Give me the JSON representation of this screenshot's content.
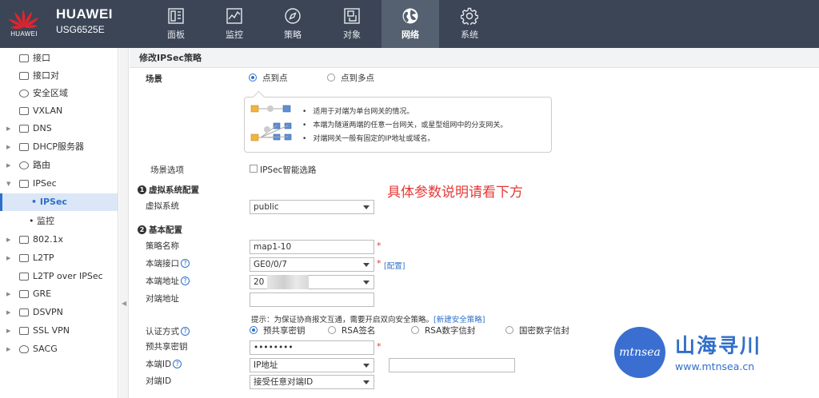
{
  "header": {
    "logo_text": "HUAWEI",
    "brand": "HUAWEI",
    "model": "USG6525E",
    "tabs": [
      {
        "label": "面板",
        "icon": "dashboard-icon"
      },
      {
        "label": "监控",
        "icon": "monitor-icon"
      },
      {
        "label": "策略",
        "icon": "compass-icon"
      },
      {
        "label": "对象",
        "icon": "object-icon"
      },
      {
        "label": "网络",
        "icon": "globe-icon",
        "active": true
      },
      {
        "label": "系统",
        "icon": "gear-icon"
      }
    ]
  },
  "sidebar": {
    "items": [
      {
        "label": "接口",
        "expandable": false
      },
      {
        "label": "接口对",
        "expandable": false
      },
      {
        "label": "安全区域",
        "expandable": false
      },
      {
        "label": "VXLAN",
        "expandable": false
      },
      {
        "label": "DNS",
        "expandable": true
      },
      {
        "label": "DHCP服务器",
        "expandable": true
      },
      {
        "label": "路由",
        "expandable": true
      },
      {
        "label": "IPSec",
        "expandable": true,
        "expanded": true
      },
      {
        "label": "IPSec",
        "sub": true,
        "active": true
      },
      {
        "label": "监控",
        "sub": true
      },
      {
        "label": "802.1x",
        "expandable": true
      },
      {
        "label": "L2TP",
        "expandable": true
      },
      {
        "label": "L2TP over IPSec",
        "expandable": false
      },
      {
        "label": "GRE",
        "expandable": true
      },
      {
        "label": "DSVPN",
        "expandable": true
      },
      {
        "label": "SSL VPN",
        "expandable": true
      },
      {
        "label": "SACG",
        "expandable": true
      }
    ]
  },
  "page": {
    "title": "修改IPSec策略",
    "scene_label": "场景",
    "scene_options": [
      "点到点",
      "点到多点"
    ],
    "scene_selected": 0,
    "scene_info": [
      "适用于对端为单台网关的情况。",
      "本端为隧道两端的任意一台网关，或星型组网中的分支网关。",
      "对端网关一般有固定的IP地址或域名。"
    ],
    "scene_option_label": "场景选项",
    "smart_route_label": "IPSec智能选路",
    "section1": "虚拟系统配置",
    "vsys_label": "虚拟系统",
    "vsys_value": "public",
    "section2": "基本配置",
    "policy_name_label": "策略名称",
    "policy_name_value": "map1-10",
    "local_if_label": "本端接口",
    "local_if_value": "GE0/0/7",
    "config_link": "[配置]",
    "local_addr_label": "本端地址",
    "local_addr_value": "20",
    "peer_addr_label": "对端地址",
    "peer_addr_value": "",
    "tip_text": "提示：为保证协商报文互通，需要开启双向安全策略。",
    "tip_link": "[新建安全策略]",
    "auth_label": "认证方式",
    "auth_options": [
      "预共享密钥",
      "RSA签名",
      "RSA数字信封",
      "国密数字信封"
    ],
    "auth_selected": 0,
    "psk_label": "预共享密钥",
    "psk_value": "••••••••",
    "local_id_label": "本端ID",
    "local_id_value": "IP地址",
    "local_id_extra": "",
    "peer_id_label": "对端ID",
    "peer_id_value": "接受任意对端ID",
    "required_mark": "*",
    "help_mark": "?",
    "annotation": "具体参数说明请看下方"
  },
  "watermark": {
    "logo": "mtnsea",
    "name": "山海寻川",
    "url": "www.mtnsea.cn"
  },
  "colors": {
    "header_bg": "#3b4556",
    "accent": "#2f6fc9",
    "annotation": "#e53935",
    "huawei_red": "#e0242e"
  }
}
